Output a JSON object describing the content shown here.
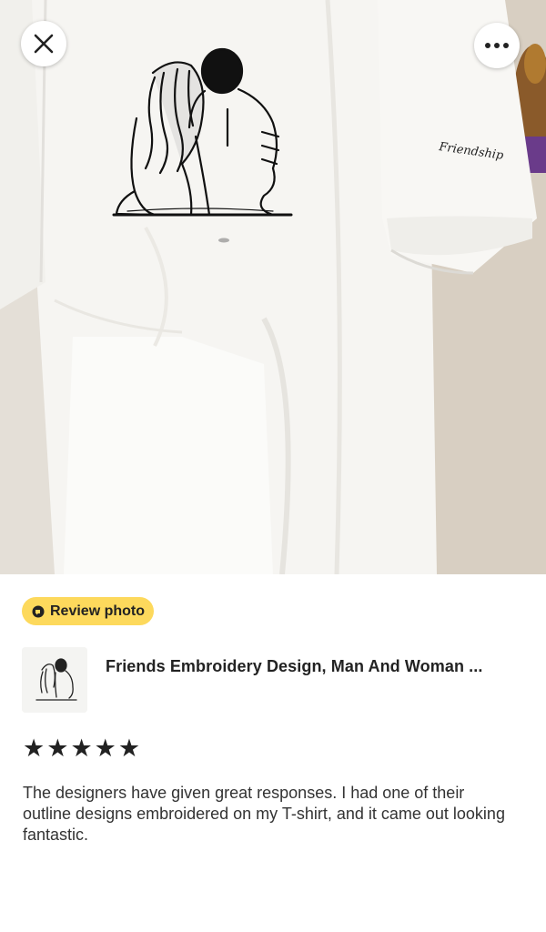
{
  "photo": {
    "alt": "Review photo of embroidered white T-shirt",
    "sleeve_text": "Friendship"
  },
  "toolbar": {
    "close_icon": "close-icon",
    "more_icon": "more-horizontal-icon"
  },
  "badge": {
    "label": "Review photo",
    "icon": "photo-review-icon",
    "color": "#fdd95c"
  },
  "product": {
    "title": "Friends Embroidery Design, Man And Woman ..."
  },
  "review": {
    "rating": 5,
    "max_rating": 5,
    "stars": [
      "★",
      "★",
      "★",
      "★",
      "★"
    ],
    "text": "The designers have given great responses. I had one of their outline designs embroidered on my T-shirt, and it came out looking fantastic."
  }
}
